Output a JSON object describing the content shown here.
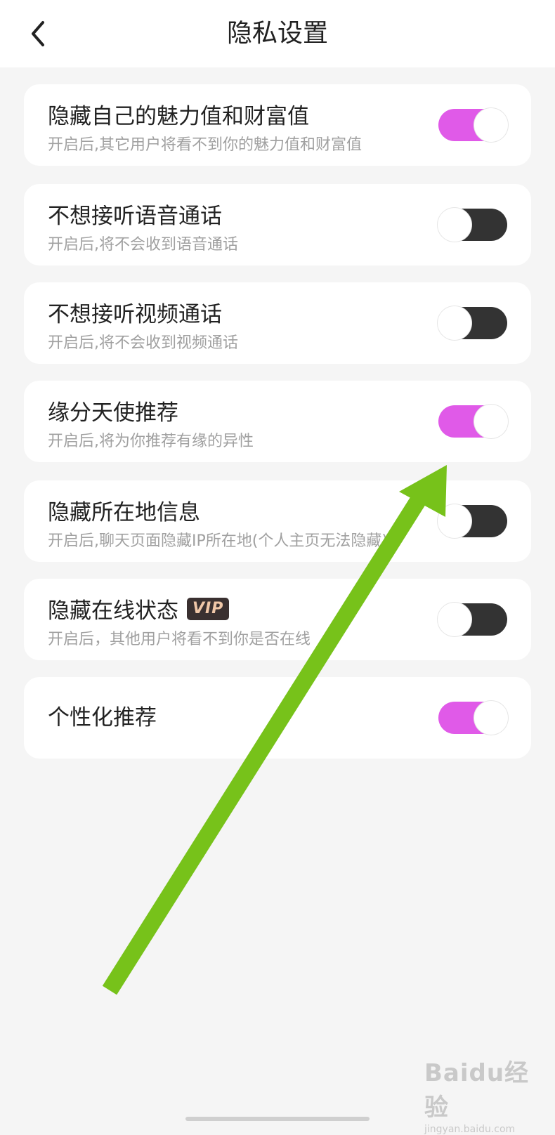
{
  "header": {
    "title": "隐私设置",
    "back_icon": "chevron-left-icon"
  },
  "settings": [
    {
      "title": "隐藏自己的魅力值和财富值",
      "subtitle": "开启后,其它用户将看不到你的魅力值和财富值",
      "enabled": true
    },
    {
      "title": "不想接听语音通话",
      "subtitle": "开启后,将不会收到语音通话",
      "enabled": false
    },
    {
      "title": "不想接听视频通话",
      "subtitle": "开启后,将不会收到视频通话",
      "enabled": false
    },
    {
      "title": "缘分天使推荐",
      "subtitle": "开启后,将为你推荐有缘的异性",
      "enabled": true
    },
    {
      "title": "隐藏所在地信息",
      "subtitle": "开启后,聊天页面隐藏IP所在地(个人主页无法隐藏)",
      "enabled": false
    },
    {
      "title": "隐藏在线状态",
      "badge": "VIP",
      "subtitle": "开启后，其他用户将看不到你是否在线",
      "enabled": false
    },
    {
      "title": "个性化推荐",
      "enabled": true
    }
  ],
  "colors": {
    "toggle_on": "#e05ae8",
    "toggle_off": "#333333",
    "annotation_arrow": "#77c21a"
  },
  "watermark": {
    "logo": "Baidu经验",
    "url": "jingyan.baidu.com"
  }
}
